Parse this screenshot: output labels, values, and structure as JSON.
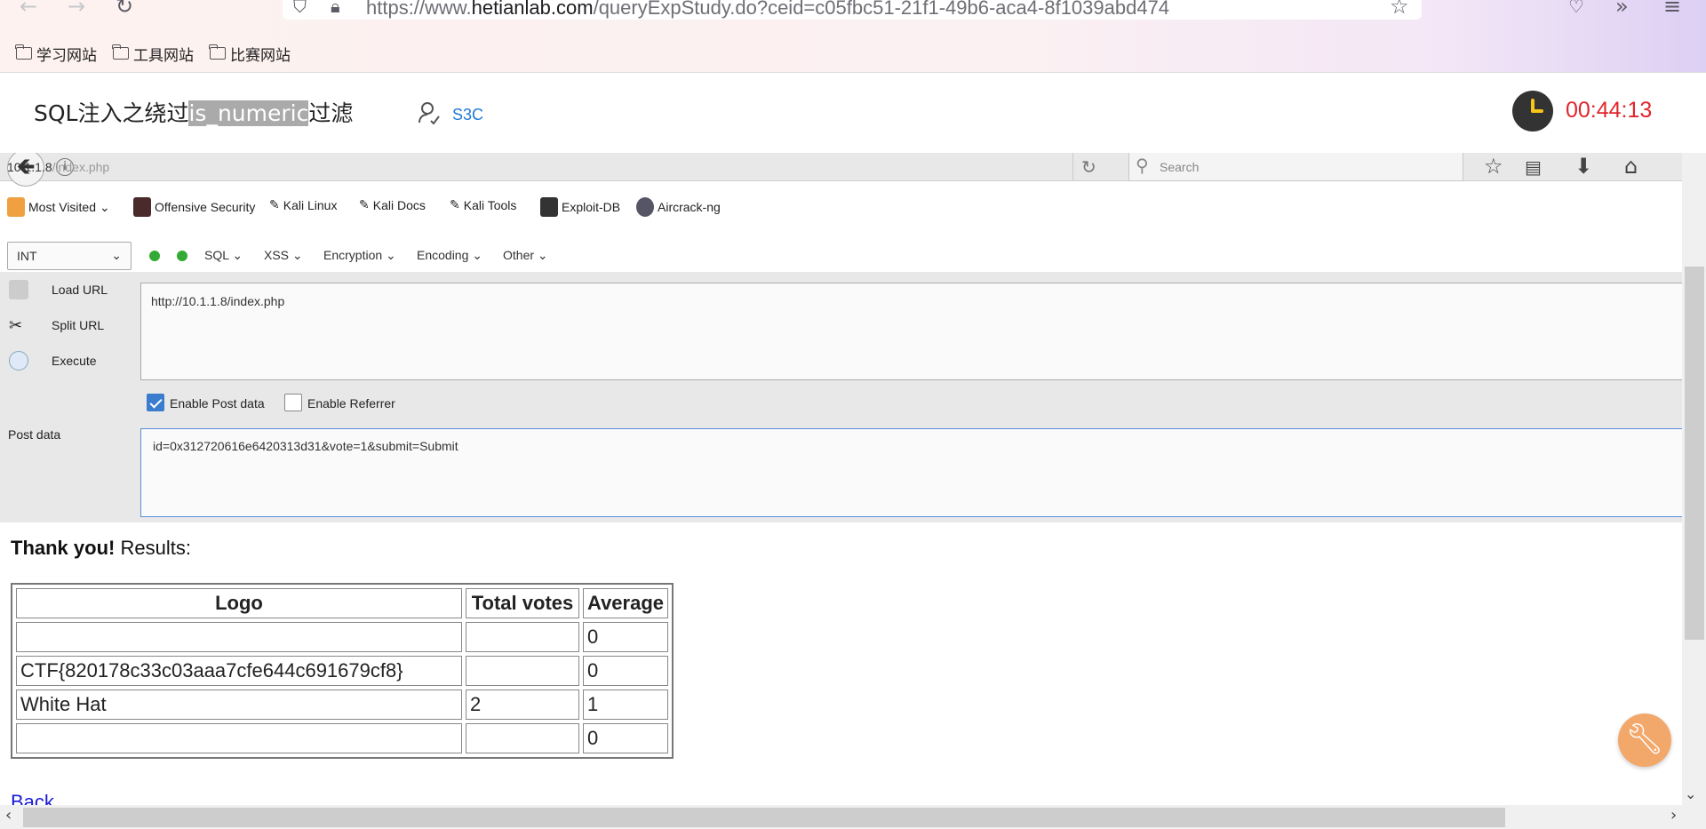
{
  "browser": {
    "url_prefix": "https://www.",
    "url_host": "hetianlab.com",
    "url_path": "/queryExpStudy.do?ceid=c05fbc51-21f1-49b6-aca4-8f1039abd474",
    "bookmarks": [
      "学习网站",
      "工具网站",
      "比赛网站"
    ]
  },
  "lab": {
    "title_prefix": "SQL注入之绕过",
    "title_highlight": "is_numeric",
    "title_suffix": "过滤",
    "user": "S3C",
    "timer": "00:44:13",
    "timer_color": "#e0262d"
  },
  "vm_browser": {
    "url_host": "10.1.1.8",
    "url_path": "/index.php",
    "search_placeholder": "Search",
    "bookmarks": [
      "Most Visited",
      "Offensive Security",
      "Kali Linux",
      "Kali Docs",
      "Kali Tools",
      "Exploit-DB",
      "Aircrack-ng"
    ]
  },
  "hackbar": {
    "select_value": "INT",
    "menus": [
      "SQL",
      "XSS",
      "Encryption",
      "Encoding",
      "Other"
    ],
    "load_url": "Load URL",
    "split_url": "Split URL",
    "execute": "Execute",
    "url_value": "http://10.1.1.8/index.php",
    "enable_post": "Enable Post data",
    "enable_referrer": "Enable Referrer",
    "post_label": "Post data",
    "post_value": "id=0x312720616e6420313d31&vote=1&submit=Submit"
  },
  "page": {
    "thanks_bold": "Thank you!",
    "thanks_rest": " Results:",
    "headers": [
      "Logo",
      "Total votes",
      "Average"
    ],
    "rows": [
      [
        "",
        "",
        "0"
      ],
      [
        "CTF{820178c33c03aaa7cfe644c691679cf8}",
        "",
        "0"
      ],
      [
        "White Hat",
        "2",
        "1"
      ],
      [
        "",
        "",
        "0"
      ]
    ],
    "back": "Back"
  }
}
